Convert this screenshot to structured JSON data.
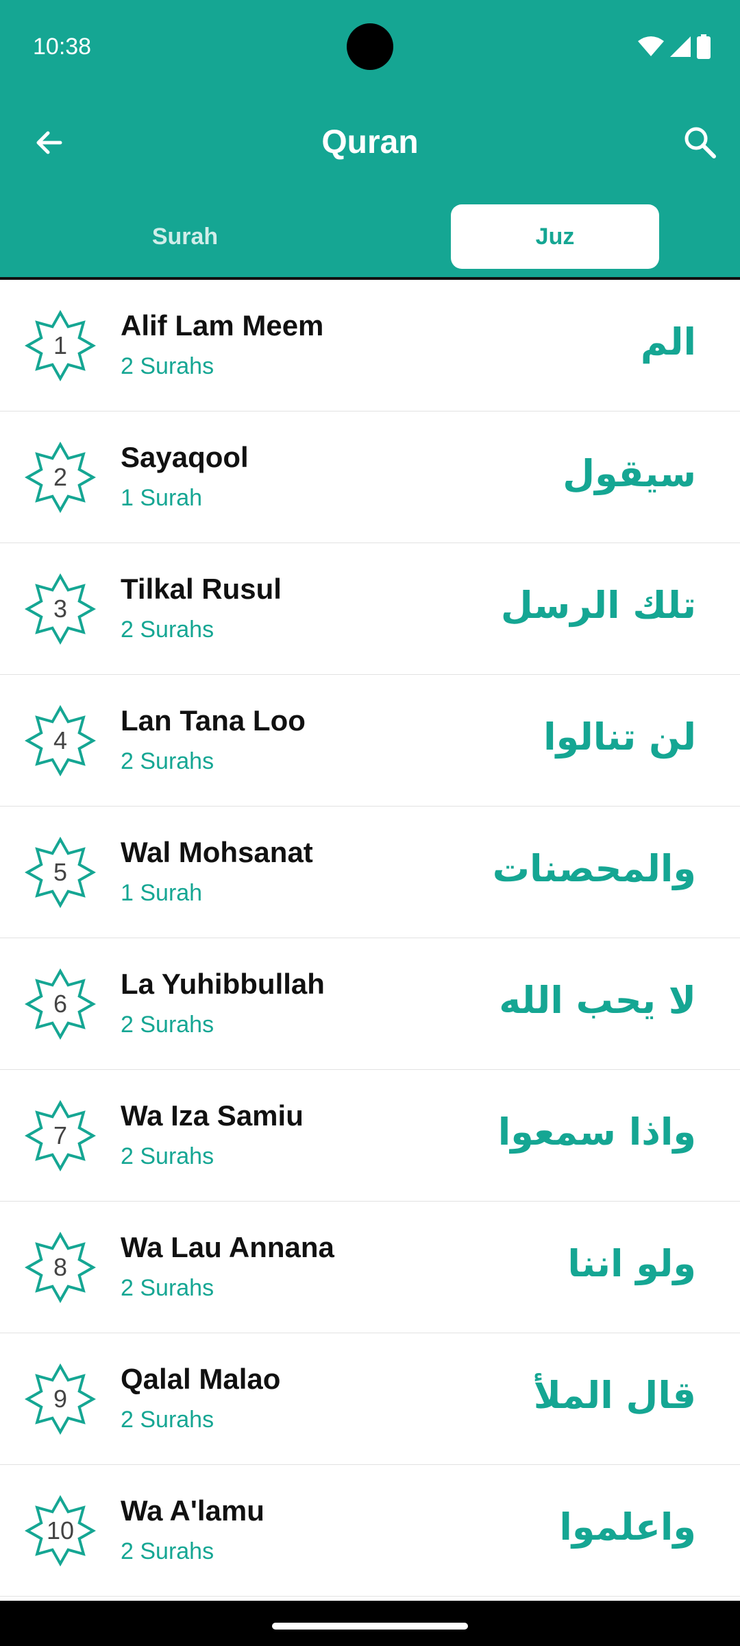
{
  "status_bar": {
    "time": "10:38",
    "icons": [
      "wifi-icon",
      "cellular-signal-icon",
      "battery-icon"
    ]
  },
  "app_bar": {
    "title": "Quran",
    "back_icon": "arrow-back-icon",
    "search_icon": "search-icon"
  },
  "tabs": [
    {
      "label": "Surah",
      "selected": false
    },
    {
      "label": "Juz",
      "selected": true
    }
  ],
  "colors": {
    "primary": "#15a693",
    "background": "#ffffff",
    "text_primary": "#111111",
    "divider": "#e2e2e2"
  },
  "juz_list": [
    {
      "number": "1",
      "name": "Alif Lam Meem",
      "surahs": "2 Surahs",
      "arabic": "الم"
    },
    {
      "number": "2",
      "name": "Sayaqool",
      "surahs": "1 Surah",
      "arabic": "سيقول"
    },
    {
      "number": "3",
      "name": "Tilkal Rusul",
      "surahs": "2 Surahs",
      "arabic": "تلك الرسل"
    },
    {
      "number": "4",
      "name": "Lan Tana Loo",
      "surahs": "2 Surahs",
      "arabic": "لن تنالوا"
    },
    {
      "number": "5",
      "name": "Wal Mohsanat",
      "surahs": "1 Surah",
      "arabic": "والمحصنات"
    },
    {
      "number": "6",
      "name": "La Yuhibbullah",
      "surahs": "2 Surahs",
      "arabic": "لا يحب الله"
    },
    {
      "number": "7",
      "name": "Wa Iza Samiu",
      "surahs": "2 Surahs",
      "arabic": "واذا سمعوا"
    },
    {
      "number": "8",
      "name": "Wa Lau Annana",
      "surahs": "2 Surahs",
      "arabic": "ولو اننا"
    },
    {
      "number": "9",
      "name": "Qalal Malao",
      "surahs": "2 Surahs",
      "arabic": "قال الملأ"
    },
    {
      "number": "10",
      "name": "Wa A'lamu",
      "surahs": "2 Surahs",
      "arabic": "واعلموا"
    }
  ]
}
